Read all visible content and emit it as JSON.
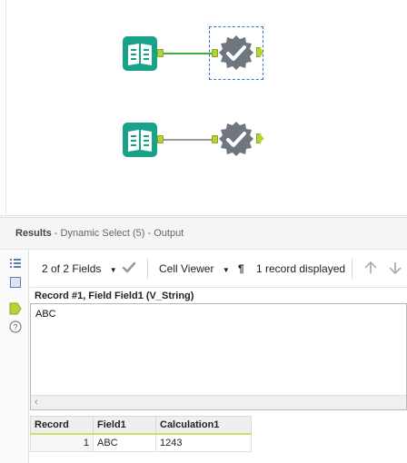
{
  "results": {
    "label": "Results",
    "subtitle": " - Dynamic Select (5) - Output"
  },
  "toolbar": {
    "fields_label": "2 of 2 Fields",
    "viewer_label": "Cell Viewer",
    "records_label": "1 record displayed"
  },
  "cell_viewer": {
    "header": "Record #1, Field Field1 (V_String)",
    "value": "ABC"
  },
  "grid": {
    "columns": [
      "Record",
      "Field1",
      "Calculation1"
    ],
    "rows": [
      [
        "1",
        "ABC",
        "1243"
      ]
    ]
  },
  "icons": {
    "input": "book-input-icon",
    "dynamic_select": "dynamic-select-icon",
    "check": "checkmark-icon",
    "paragraph": "pilcrow-icon",
    "up": "arrow-up-icon",
    "down": "arrow-down-icon"
  },
  "colors": {
    "input_tool": "#17a38a",
    "select_tool": "#6e7780",
    "connection_active": "#3fae49",
    "connection_inactive": "#9a9a9a",
    "anchor": "#b5d334",
    "selection": "#3b73c4"
  }
}
